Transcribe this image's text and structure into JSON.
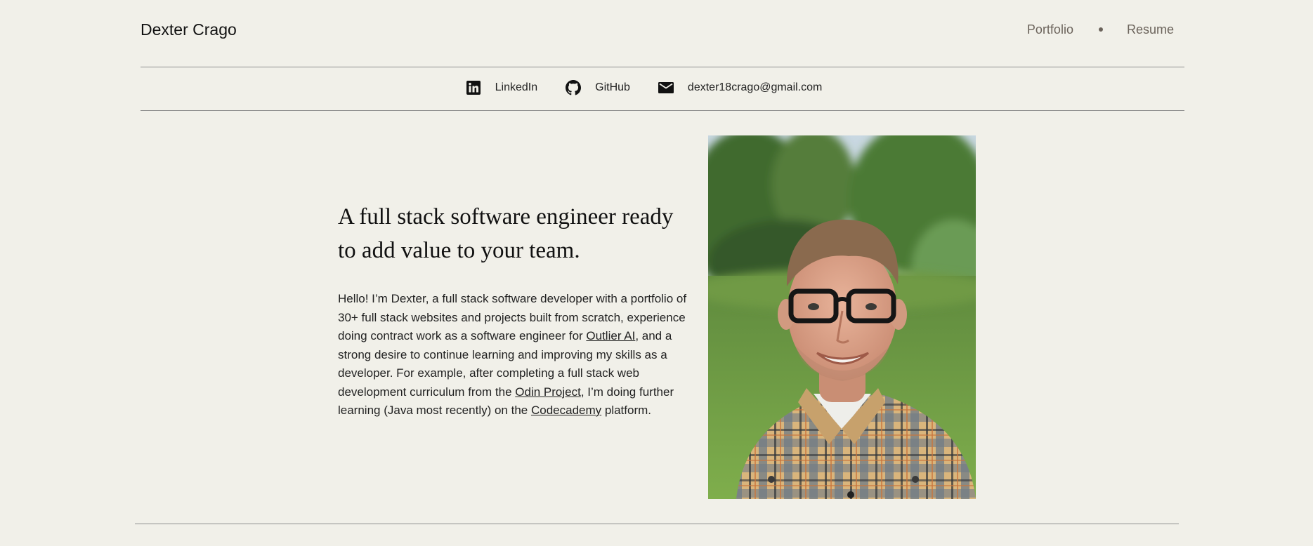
{
  "header": {
    "site_name": "Dexter Crago",
    "nav": [
      {
        "label": "Portfolio"
      },
      {
        "label": "Resume"
      }
    ]
  },
  "social": {
    "linkedin_label": "LinkedIn",
    "github_label": "GitHub",
    "email_label": "dexter18crago@gmail.com",
    "icons": [
      "linkedin-icon",
      "github-icon",
      "mail-icon"
    ]
  },
  "hero": {
    "heading": "A full stack software engineer ready to add value to your team.",
    "bio": {
      "part1": "Hello! I’m Dexter, a full stack software developer with a portfolio of 30+ full stack websites and projects built from scratch, experience doing contract work as a software engineer for ",
      "link1": "Outlier AI",
      "part2": ", and a strong desire to continue learning and improving my skills as a developer. For example, after completing a full stack web development curriculum from the ",
      "link2": "Odin Project",
      "part3": ", I’m doing further learning (Java most recently) on the ",
      "link3": "Codecademy",
      "part4": " platform."
    }
  },
  "colors": {
    "background": "#f1f0e9",
    "nav_text": "#6b635b",
    "rule": "#8e8e8e",
    "text": "#222222"
  }
}
